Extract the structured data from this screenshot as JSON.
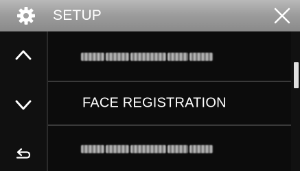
{
  "header": {
    "title": "SETUP",
    "icon": "gear-icon",
    "close_icon": "close-icon"
  },
  "nav": {
    "up_icon": "chevron-up-icon",
    "down_icon": "chevron-down-icon",
    "back_icon": "return-arrow-icon"
  },
  "menu": {
    "items": [
      {
        "label": ""
      },
      {
        "label": "FACE REGISTRATION"
      },
      {
        "label": ""
      }
    ]
  },
  "scrollbar": {
    "position": 0.18
  },
  "colors": {
    "title_bar": "#9c9c9c",
    "background": "#0c0c0c",
    "text": "#ffffff",
    "divider": "#3a3a3a"
  }
}
